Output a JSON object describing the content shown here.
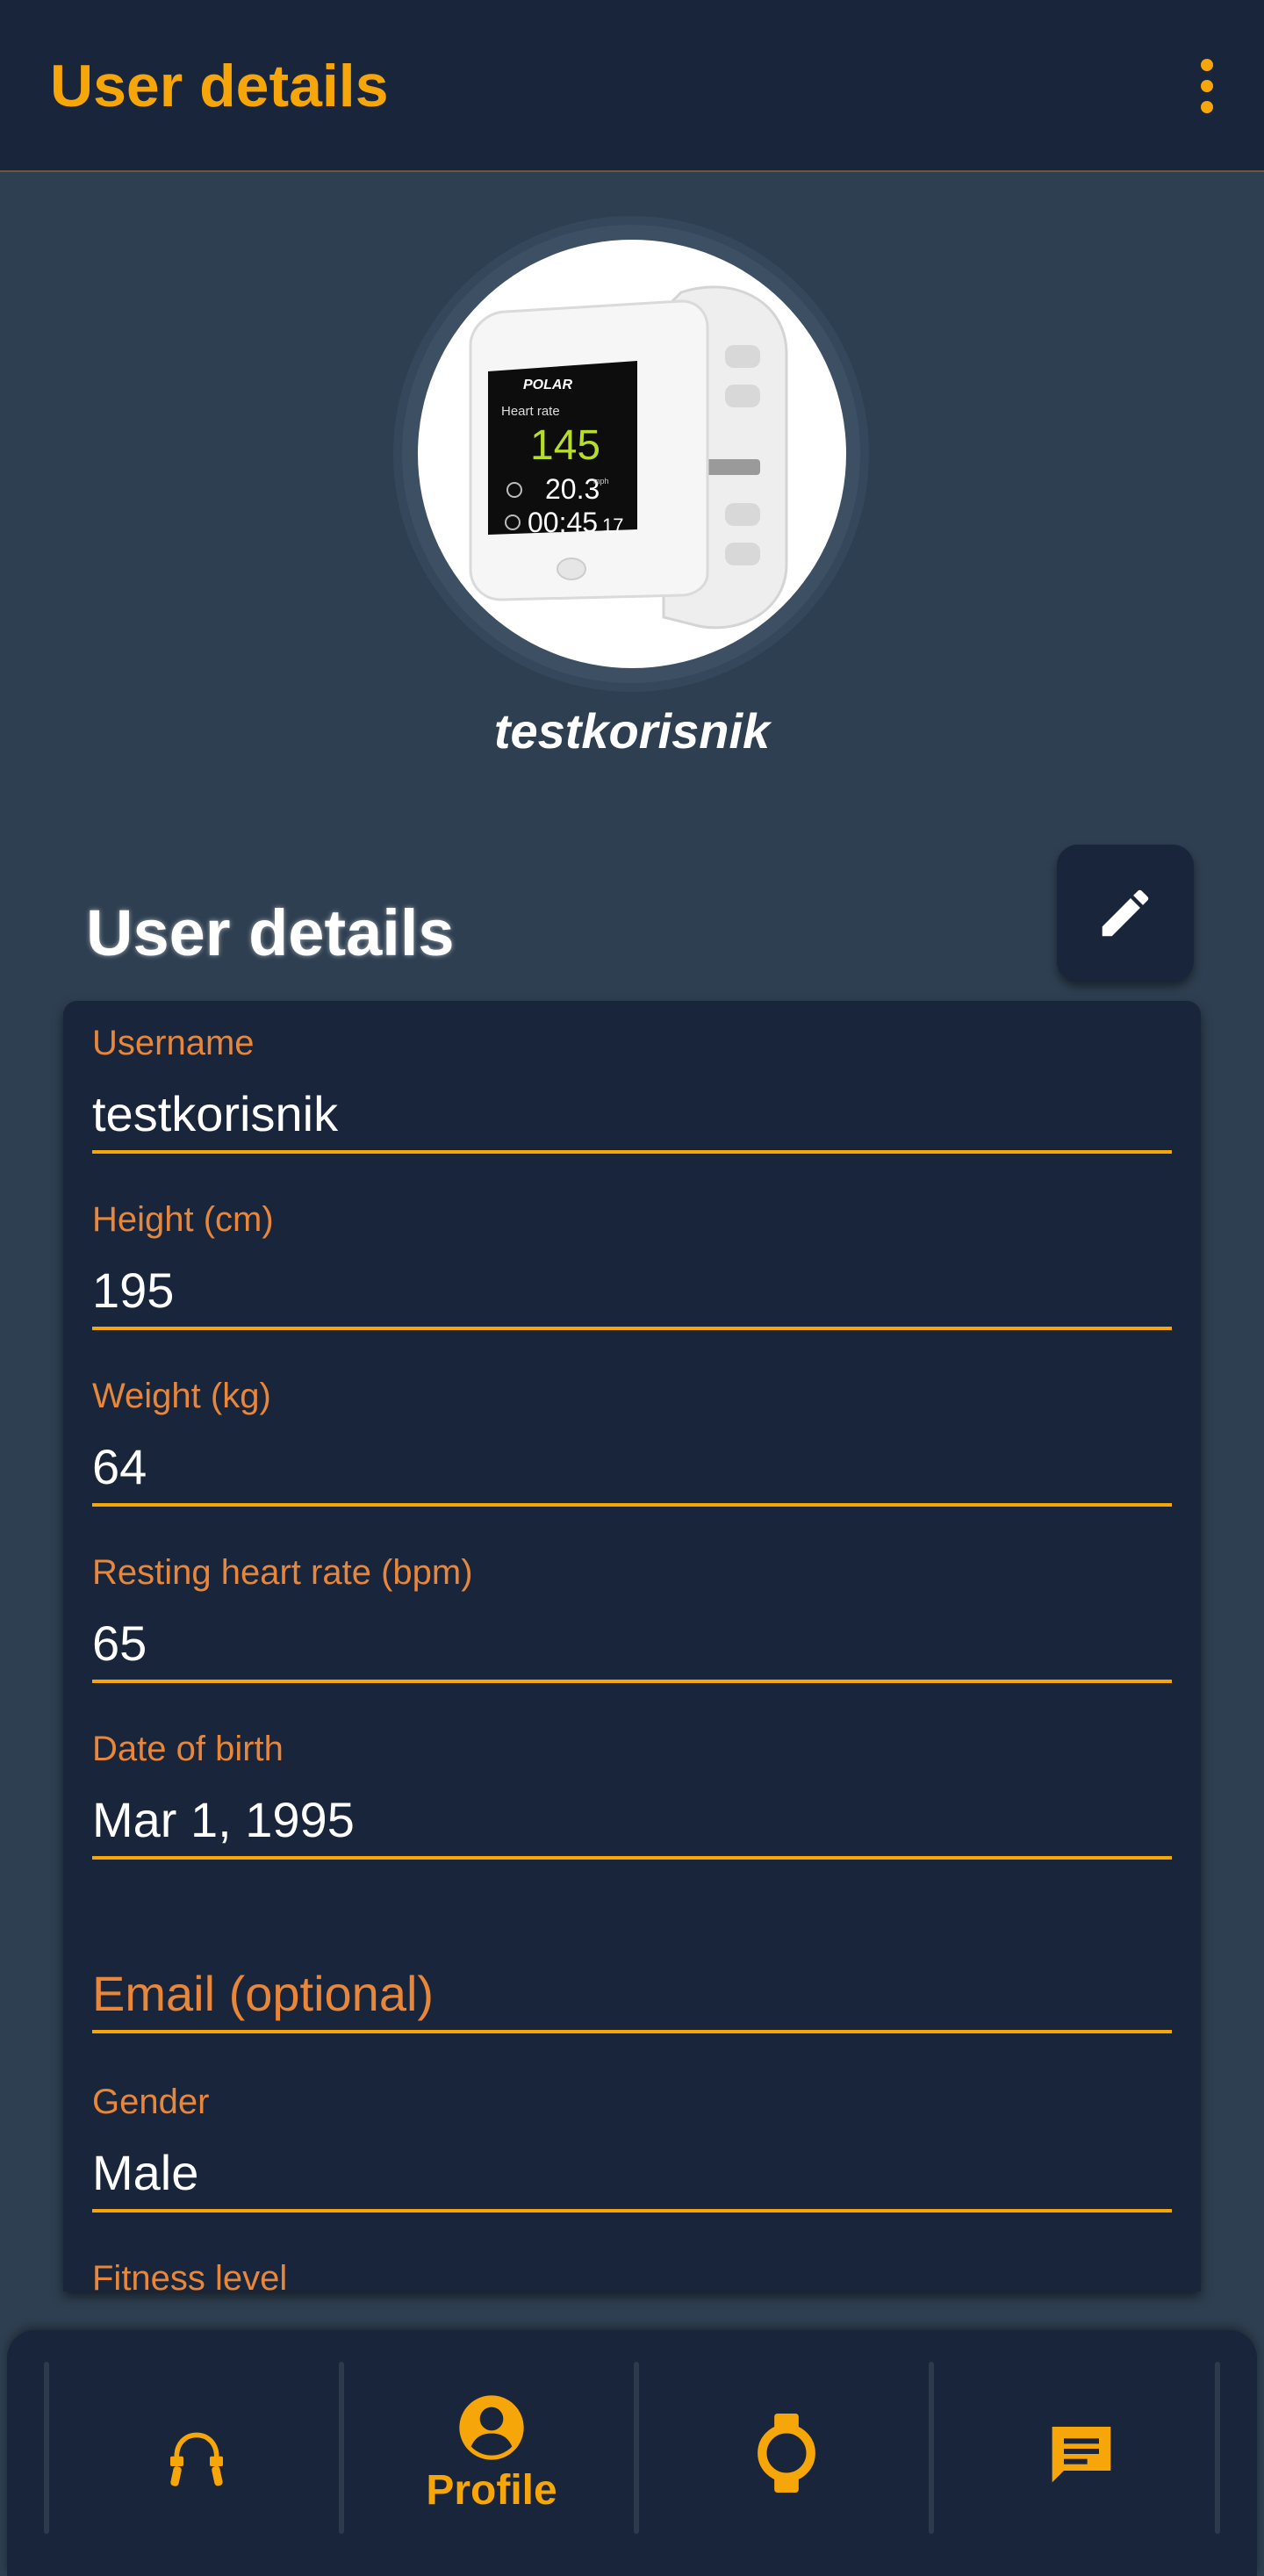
{
  "appbar": {
    "title": "User details",
    "menu_icon": "more-vert-icon"
  },
  "profile": {
    "username_display": "testkorisnik",
    "watch_screen": {
      "brand": "POLAR",
      "metric_label": "Heart rate",
      "heart_rate": "145",
      "speed": "20.3",
      "speed_unit": "mph",
      "time_main": "00:45",
      "time_sub": "17"
    }
  },
  "section": {
    "title": "User details",
    "edit_icon": "edit-pencil-icon"
  },
  "fields": [
    {
      "label": "Username",
      "value": "testkorisnik"
    },
    {
      "label": "Height (cm)",
      "value": "195"
    },
    {
      "label": "Weight (kg)",
      "value": "64"
    },
    {
      "label": "Resting heart rate (bpm)",
      "value": "65"
    },
    {
      "label": "Date of birth",
      "value": "Mar 1, 1995"
    },
    {
      "label": "",
      "value": "",
      "placeholder": "Email (optional)"
    },
    {
      "label": "Gender",
      "value": "Male"
    },
    {
      "label": "Fitness level",
      "value": ""
    }
  ],
  "bottom_nav": {
    "items": [
      {
        "icon": "jump-rope-icon",
        "label": ""
      },
      {
        "icon": "account-circle-icon",
        "label": "Profile"
      },
      {
        "icon": "watch-icon",
        "label": ""
      },
      {
        "icon": "chat-message-icon",
        "label": ""
      }
    ]
  },
  "colors": {
    "accent": "#f7a60a",
    "label": "#e8863a",
    "surface": "#18253a",
    "background": "#2e3f51"
  }
}
